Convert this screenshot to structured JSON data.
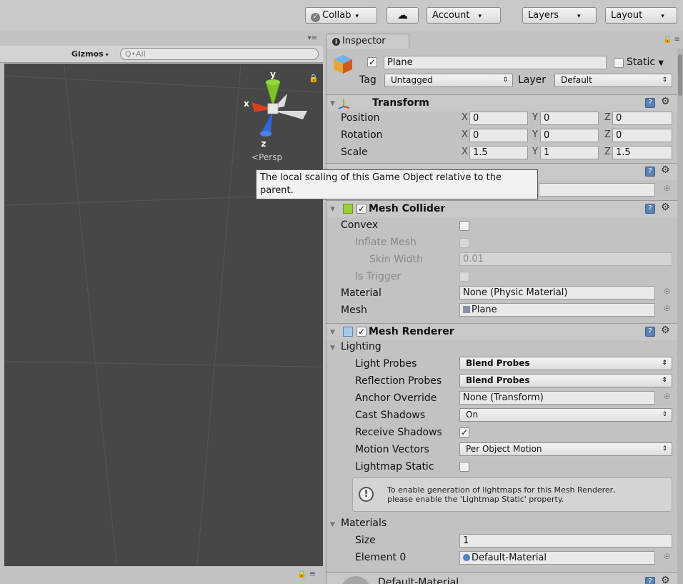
{
  "toolbar": {
    "collab": "Collab",
    "account": "Account",
    "layers": "Layers",
    "layout": "Layout"
  },
  "scene": {
    "gizmos": "Gizmos",
    "search_placeholder": "Q•All",
    "axis_x": "x",
    "axis_y": "y",
    "axis_z": "z",
    "projection": "Persp"
  },
  "tooltip": "The local scaling of this Game Object relative to the parent.",
  "inspector": {
    "tab": "Inspector",
    "object": {
      "name": "Plane",
      "static_label": "Static",
      "tag_label": "Tag",
      "tag_value": "Untagged",
      "layer_label": "Layer",
      "layer_value": "Default"
    },
    "transform": {
      "title": "Transform",
      "position_label": "Position",
      "rotation_label": "Rotation",
      "scale_label": "Scale",
      "axis_x": "X",
      "axis_y": "Y",
      "axis_z": "Z",
      "position": {
        "x": "0",
        "y": "0",
        "z": "0"
      },
      "rotation": {
        "x": "0",
        "y": "0",
        "z": "0"
      },
      "scale": {
        "x": "1.5",
        "y": "1",
        "z": "1.5"
      }
    },
    "mesh_collider": {
      "title": "Mesh Collider",
      "convex": "Convex",
      "inflate_mesh": "Inflate Mesh",
      "skin_width": "Skin Width",
      "skin_width_value": "0.01",
      "is_trigger": "Is Trigger",
      "material_label": "Material",
      "material_value": "None (Physic Material)",
      "mesh_label": "Mesh",
      "mesh_value": "Plane"
    },
    "mesh_renderer": {
      "title": "Mesh Renderer",
      "lighting": "Lighting",
      "light_probes_label": "Light Probes",
      "light_probes_value": "Blend Probes",
      "reflection_probes_label": "Reflection Probes",
      "reflection_probes_value": "Blend Probes",
      "anchor_override_label": "Anchor Override",
      "anchor_override_value": "None (Transform)",
      "cast_shadows_label": "Cast Shadows",
      "cast_shadows_value": "On",
      "receive_shadows_label": "Receive Shadows",
      "motion_vectors_label": "Motion Vectors",
      "motion_vectors_value": "Per Object Motion",
      "lightmap_static_label": "Lightmap Static",
      "info_line1": "To enable generation of lightmaps for this Mesh Renderer,",
      "info_line2": "please enable the 'Lightmap Static' property.",
      "materials": "Materials",
      "size_label": "Size",
      "size_value": "1",
      "element0_label": "Element 0",
      "element0_value": "Default-Material"
    },
    "material_preview": "Default-Material"
  },
  "colors": {
    "scene_background": "#474747",
    "panel_background": "#c2c2c2",
    "axis_x": "#d6411f",
    "axis_y": "#7ec42a",
    "axis_z": "#2f68d8"
  }
}
